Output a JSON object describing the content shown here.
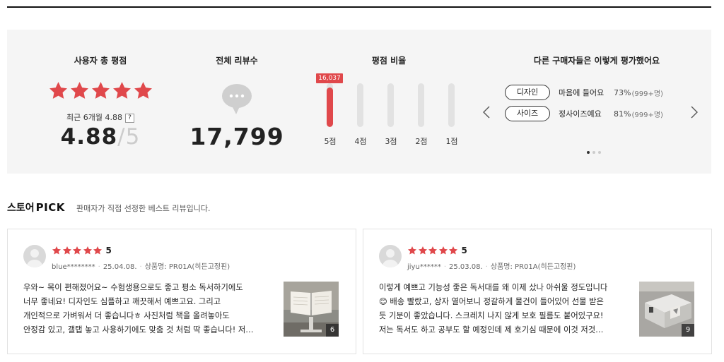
{
  "summary": {
    "rating": {
      "title": "사용자 총 평점",
      "recent_label": "최근 6개월 4.88",
      "help": "?",
      "score": "4.88",
      "slash": "/",
      "max": "5",
      "stars": 5
    },
    "count": {
      "title": "전체 리뷰수",
      "value": "17,799"
    },
    "ratio": {
      "title": "평점 비율",
      "bars": [
        {
          "label": "5점",
          "tag": "16,037",
          "fraction": 0.9
        },
        {
          "label": "4점",
          "tag": "",
          "fraction": 0
        },
        {
          "label": "3점",
          "tag": "",
          "fraction": 0
        },
        {
          "label": "2점",
          "tag": "",
          "fraction": 0
        },
        {
          "label": "1점",
          "tag": "",
          "fraction": 0
        }
      ]
    },
    "others": {
      "title": "다른 구매자들은 이렇게 평가했어요",
      "items": [
        {
          "tag": "디자인",
          "text": "마음에 들어요",
          "pct": "73%",
          "count": "(999+명)"
        },
        {
          "tag": "사이즈",
          "text": "정사이즈예요",
          "pct": "81%",
          "count": "(999+명)"
        }
      ],
      "page_count": 3,
      "active_page": 1
    }
  },
  "pick": {
    "title": "스토어",
    "title_bold": "PICK",
    "subtitle": "판매자가 직접 선정한 베스트 리뷰입니다."
  },
  "reviews": [
    {
      "score": "5",
      "stars": 5,
      "user": "blue********",
      "date": "25.04.08.",
      "product": "상품명: PR01A(히든고정핀)",
      "lines": [
        "우와~ 목이 편해졌어요~ 수험생용으로도 좋고 평소 독서하기에도",
        "너무 좋네요! 디자인도 심플하고 깨끗해서 예쁘고요. 그리고",
        "개인적으로 가벼워서 더 좋습니다ㅎ 사진처럼 책을 올려놓아도",
        "안정감 있고, 갤탭 놓고 사용하기에도 맞춤 것 처럼 딱 좋습니다! 저…"
      ],
      "photo_count": "6"
    },
    {
      "score": "5",
      "stars": 5,
      "user": "jiyu******",
      "date": "25.03.08.",
      "product": "상품명: PR01A(히든고정핀)",
      "lines": [
        "이렇게 예쁘고 기능성 좋은 독서대를 왜 이제 샀나 아쉬울 정도입니다",
        "😊 배송 빨랐고, 상자 열어보니 정갈하게 물건이 들어있어 선물 받은",
        "듯 기분이 좋았습니다. 스크레치 나지 않게 보호 필름도 붙어있구요!",
        "저는 독서도 하고 공부도 할 예정인데 제 호기심 때문에 이것 저것…"
      ],
      "photo_count": "9"
    }
  ],
  "colors": {
    "accent": "#e0484b",
    "panel": "#f5f5f5"
  }
}
